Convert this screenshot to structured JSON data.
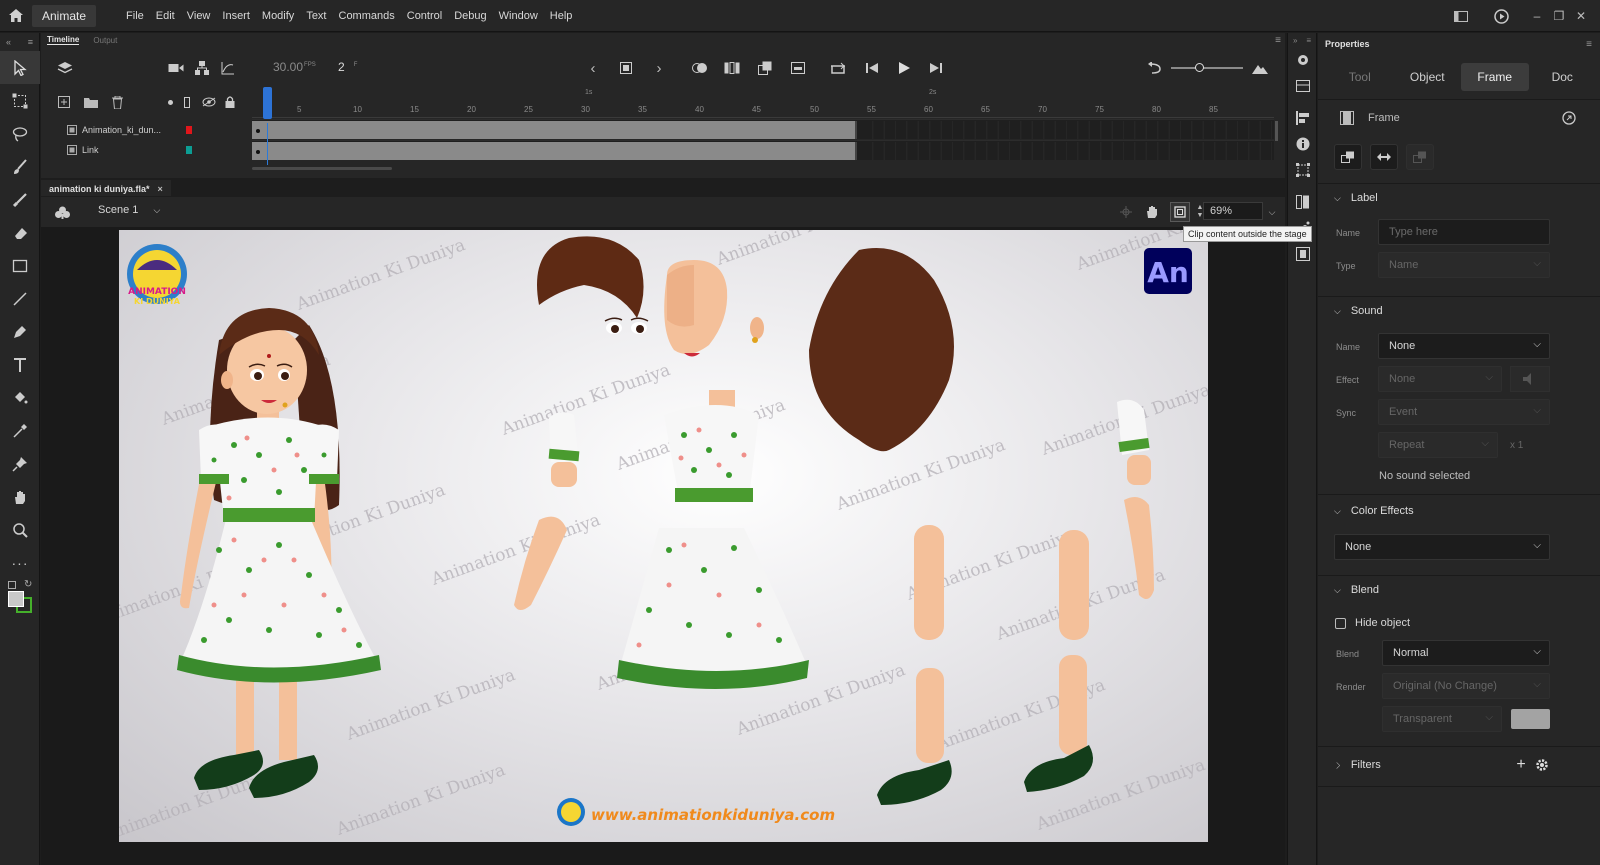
{
  "app": {
    "name": "Animate",
    "menu": [
      "File",
      "Edit",
      "View",
      "Insert",
      "Modify",
      "Text",
      "Commands",
      "Control",
      "Debug",
      "Window",
      "Help"
    ]
  },
  "timeline": {
    "tabs": [
      "Timeline",
      "Output"
    ],
    "fps_value": "30.00",
    "fps_unit": "FPS",
    "current_frame": "2",
    "frame_unit": "F",
    "ruler_numbers": [
      "5",
      "10",
      "15",
      "20",
      "25",
      "30",
      "35",
      "40",
      "45",
      "50",
      "55",
      "60",
      "65",
      "70",
      "75",
      "80",
      "85"
    ],
    "second_marks": [
      "1s",
      "2s"
    ],
    "layers": [
      {
        "name": "Animation_ki_dun...",
        "color": "#e0161b"
      },
      {
        "name": "Link",
        "color": "#0c9d93"
      }
    ]
  },
  "document": {
    "tab_title": "animation ki duniya.fla*",
    "scene": "Scene 1",
    "zoom": "69%",
    "tooltip": "Clip content outside the stage"
  },
  "stage": {
    "watermark": "Animation Ki Duniya",
    "website": "www.animationkiduniya.com",
    "badge": "An",
    "logo_text": "ANIMATION KI DUNIYA"
  },
  "properties": {
    "title": "Properties",
    "tabs": [
      "Tool",
      "Object",
      "Frame",
      "Doc"
    ],
    "selected_tab": "Frame",
    "frame_header": "Frame",
    "label": {
      "title": "Label",
      "name_label": "Name",
      "name_placeholder": "Type here",
      "type_label": "Type",
      "type_value": "Name"
    },
    "sound": {
      "title": "Sound",
      "name_label": "Name",
      "name_value": "None",
      "effect_label": "Effect",
      "effect_value": "None",
      "sync_label": "Sync",
      "sync_value": "Event",
      "repeat_value": "Repeat",
      "repeat_count": "x 1",
      "status": "No sound selected"
    },
    "color_effects": {
      "title": "Color Effects",
      "value": "None"
    },
    "blend": {
      "title": "Blend",
      "hide_object": "Hide object",
      "blend_label": "Blend",
      "blend_value": "Normal",
      "render_label": "Render",
      "render_value": "Original (No Change)",
      "transparent_value": "Transparent"
    },
    "filters": {
      "title": "Filters"
    }
  },
  "colors": {
    "accent": "#2d73d6",
    "stage_bg": "#e4e3e6",
    "badge_bg": "#00005b",
    "badge_fg": "#9999ff"
  }
}
